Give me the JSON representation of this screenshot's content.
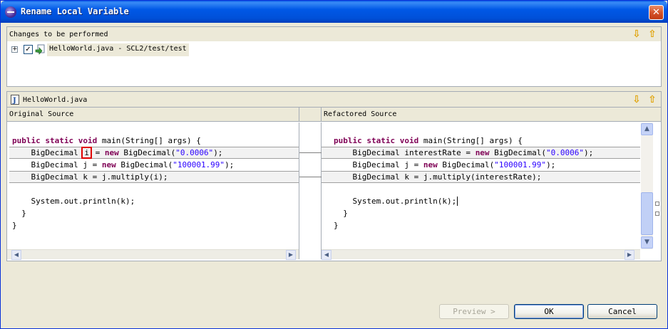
{
  "window": {
    "title": "Rename Local Variable",
    "close_glyph": "✕"
  },
  "changes": {
    "header": "Changes to be performed",
    "tree_item": "HelloWorld.java - SCL2/test/test",
    "checked": true
  },
  "compare": {
    "file_title": "HelloWorld.java",
    "left_header": "Original Source",
    "right_header": "Refactored Source"
  },
  "left_code": {
    "l1_kw": "public static void",
    "l1_rest": " main(String[] args) {",
    "l2_a": "    BigDecimal ",
    "l2_var": "i",
    "l2_b": " = ",
    "l2_new": "new",
    "l2_c": " BigDecimal(",
    "l2_str": "\"0.0006\"",
    "l2_d": ");",
    "l3_a": "    BigDecimal j = ",
    "l3_new": "new",
    "l3_b": " BigDecimal(",
    "l3_str": "\"100001.99\"",
    "l3_c": ");",
    "l4": "    BigDecimal k = j.multiply(i);",
    "l6": "    System.out.println(k);",
    "l7": "  }",
    "l8": "}"
  },
  "right_code": {
    "l1_kw": "public static void",
    "l1_rest": " main(String[] args) {",
    "l2_a": "    BigDecimal interestRate = ",
    "l2_new": "new",
    "l2_b": " BigDecimal(",
    "l2_str": "\"0.0006\"",
    "l2_c": ");",
    "l3_a": "    BigDecimal j = ",
    "l3_new": "new",
    "l3_b": " BigDecimal(",
    "l3_str": "\"100001.99\"",
    "l3_c": ");",
    "l4": "    BigDecimal k = j.multiply(interestRate);",
    "l6": "    System.out.println(k);",
    "l7": "  }",
    "l8": "}"
  },
  "buttons": {
    "preview": "Preview >",
    "ok": "OK",
    "cancel": "Cancel"
  },
  "icons": {
    "next_change": "⇩",
    "prev_change": "⇧"
  },
  "colors": {
    "keyword": "#7f0055",
    "string": "#2a00ff",
    "title_bar": "#0058e6",
    "highlight_box": "#e00000"
  }
}
